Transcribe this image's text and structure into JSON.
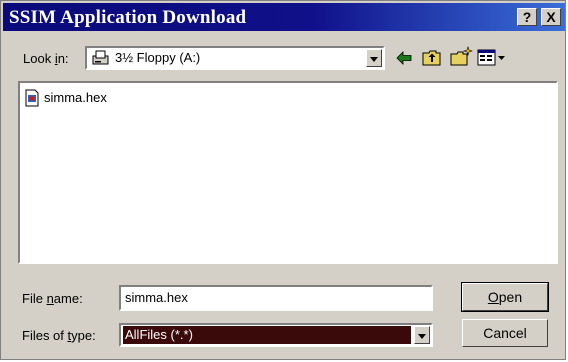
{
  "window": {
    "title": "SSIM Application Download",
    "help_label": "?",
    "close_label": "X"
  },
  "look_in": {
    "label_pre": "Look ",
    "label_mnemonic": "i",
    "label_post": "n:",
    "value": "3½ Floppy (A:)",
    "icons": [
      "floppy-drive-icon",
      "back-arrow-icon",
      "up-one-level-icon",
      "create-new-folder-icon",
      "view-menu-icon"
    ]
  },
  "files": [
    {
      "name": "simma.hex",
      "icon": "hex-file-icon"
    }
  ],
  "file_name": {
    "label_pre": "File ",
    "label_mnemonic": "n",
    "label_post": "ame:",
    "value": "simma.hex"
  },
  "file_type": {
    "label_pre": "Files of ",
    "label_mnemonic": "t",
    "label_post": "ype:",
    "value": "AllFiles (*.*)"
  },
  "buttons": {
    "open_mnemonic": "O",
    "open_rest": "pen",
    "cancel": "Cancel"
  },
  "colors": {
    "title_gradient_start": "#0a0a7a",
    "title_gradient_end": "#3a6ed8",
    "dialog_face": "#d4d0c8",
    "file_type_bg": "#3a0a0a"
  }
}
